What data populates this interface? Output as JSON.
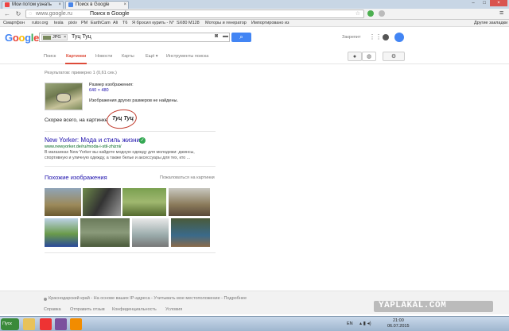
{
  "browser": {
    "tabs": [
      {
        "label": "Мои потом узнать"
      },
      {
        "label": "Поиск в Google"
      }
    ],
    "address": "www.google.ru",
    "address_title": "Поиск в Google",
    "bookmarks": [
      "Смартфон",
      "rutor.org",
      "tesla",
      "pixiv",
      "PM",
      "EarthCam",
      "Ali",
      "T6",
      "Я бросил курить - N°",
      "SX80 M128",
      "Моторы и генератор",
      "Импортировано из",
      "Другие закладки"
    ]
  },
  "google": {
    "logo": "Google",
    "search_chip": "JPG",
    "search_query": "Туц Туц",
    "signin_label": "Закрепит",
    "tabs": [
      "Поиск",
      "Картинки",
      "Новости",
      "Карты",
      "Ещё ▾",
      "Инструменты поиска"
    ],
    "active_tab": "Картинки"
  },
  "results": {
    "stats": "Результатов: примерно 1 (0,61 сек.)",
    "image_size_label": "Размер изображения:",
    "image_size": "640 × 480",
    "no_other_sizes": "Изображения других размеров не найдены.",
    "best_guess_prefix": "Скорее всего, на картинке",
    "best_guess": "Туц Туц",
    "result_title": "New Yorker: Мода и стиль жизни",
    "result_url": "www.newyorker.de/ru/moda-i-stil-zhizni/",
    "result_snippet_1": "В магазинах New Yorker вы найдете модную одежду для молодежи: джинсы,",
    "result_snippet_2": "спортивную и уличную одежду, а также белье и аксессуары для тех, кто ...",
    "similar_title": "Похожие изображения",
    "report_label": "Пожаловаться на картинки"
  },
  "footer": {
    "location": "Краснодарский край - На основе ваших IP-адреса - Учитывать мое местоположение - Подробнее",
    "links": [
      "Справка",
      "Отправить отзыв",
      "Конфиденциальность",
      "Условия"
    ]
  },
  "taskbar": {
    "start_label": "Пуск",
    "lang": "EN",
    "time": "21:00",
    "date": "06.07.2015"
  },
  "watermark": "YAPLAKAL.COM"
}
